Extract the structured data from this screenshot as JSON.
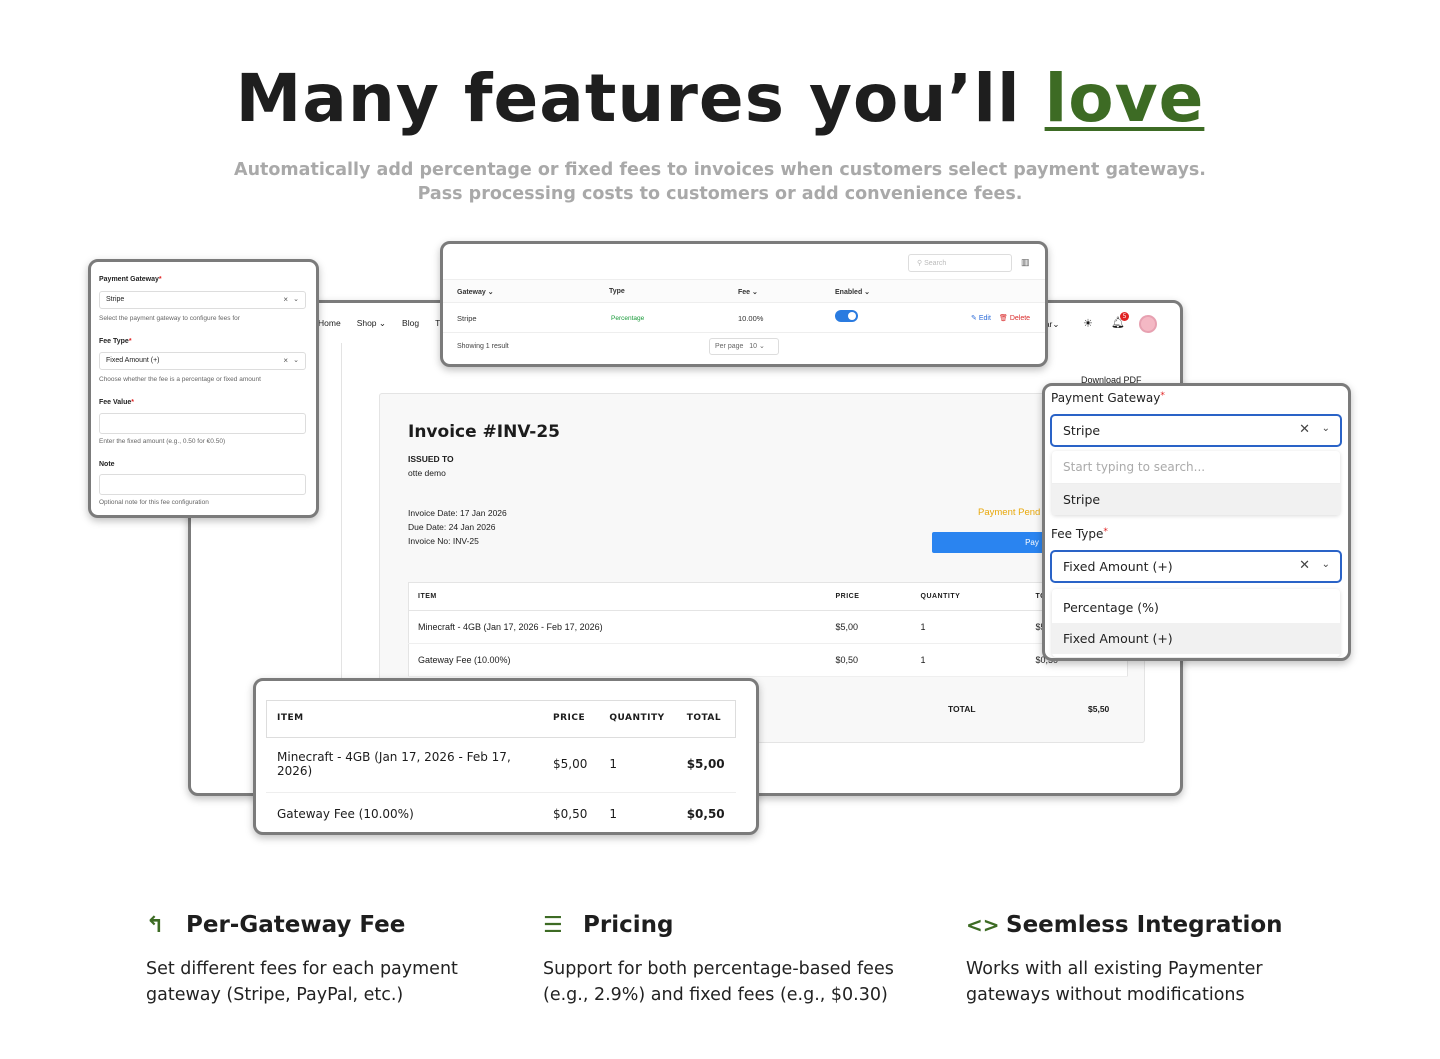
{
  "hero": {
    "title_prefix": "Many features you’ll",
    "title_highlight": "love",
    "subtitle": "Automatically add percentage or fixed fees to invoices when customers select payment gateways. Pass processing costs to customers or add convenience fees."
  },
  "main_window": {
    "nav": [
      "Home",
      "Shop",
      "Blog",
      "T"
    ],
    "currency": "llar",
    "notification_count": "5",
    "download_pdf": "Download PDF",
    "invoice": {
      "title": "Invoice #INV-25",
      "issued_to_label": "ISSUED TO",
      "issued_to_name": "otte demo",
      "invoice_date": "Invoice Date: 17 Jan 2026",
      "due_date": "Due Date: 24 Jan 2026",
      "invoice_no": "Invoice No: INV-25",
      "status": "Payment Pend",
      "pay_button": "Pay",
      "columns": [
        "ITEM",
        "PRICE",
        "QUANTITY",
        "TO"
      ],
      "rows": [
        [
          "Minecraft - 4GB (Jan 17, 2026 - Feb 17, 2026)",
          "$5,00",
          "1",
          "$5"
        ],
        [
          "Gateway Fee (10.00%)",
          "$0,50",
          "1",
          "$0,50"
        ]
      ],
      "total_label": "TOTAL",
      "total_value": "$5,50"
    }
  },
  "gateway_table": {
    "search_placeholder": "Search",
    "columns": [
      "Gateway",
      "Type",
      "Fee",
      "Enabled"
    ],
    "row": {
      "gateway": "Stripe",
      "type": "Percentage",
      "fee": "10.00%",
      "enabled": true
    },
    "edit": "Edit",
    "delete": "Delete",
    "showing": "Showing 1 result",
    "per_page_label": "Per page",
    "per_page_value": "10"
  },
  "fee_form": {
    "gateway_label": "Payment Gateway",
    "gateway_value": "Stripe",
    "gateway_help": "Select the payment gateway to configure fees for",
    "fee_type_label": "Fee Type",
    "fee_type_value": "Fixed Amount (+)",
    "fee_type_help": "Choose whether the fee is a percentage or fixed amount",
    "fee_value_label": "Fee Value",
    "fee_value_help": "Enter the fixed amount (e.g., 0.50 for €0.50)",
    "note_label": "Note",
    "note_help": "Optional note for this fee configuration"
  },
  "dropdowns": {
    "gateway_label": "Payment Gateway",
    "gateway_value": "Stripe",
    "search_placeholder": "Start typing to search...",
    "gateway_options": [
      "Stripe"
    ],
    "fee_type_label": "Fee Type",
    "fee_type_value": "Fixed Amount (+)",
    "fee_type_options": [
      "Percentage (%)",
      "Fixed Amount (+)"
    ]
  },
  "zoom_table": {
    "columns": [
      "ITEM",
      "PRICE",
      "QUANTITY",
      "TOTAL"
    ],
    "rows": [
      [
        "Minecraft - 4GB (Jan 17, 2026 - Feb 17, 2026)",
        "$5,00",
        "1",
        "$5,00"
      ],
      [
        "Gateway Fee (10.00%)",
        "$0,50",
        "1",
        "$0,50"
      ]
    ]
  },
  "features": [
    {
      "icon": "reply-arrow-icon",
      "glyph": "↰",
      "title": "Per-Gateway Fee",
      "text": "Set different fees for each payment gateway (Stripe, PayPal, etc.)"
    },
    {
      "icon": "menu-lines-icon",
      "glyph": "☰",
      "title": "Pricing",
      "text": "Support for both percentage-based fees (e.g., 2.9%) and fixed fees (e.g., $0.30)"
    },
    {
      "icon": "code-brackets-icon",
      "glyph": "<>",
      "title": "Seemless Integration",
      "text": "Works with all existing Paymenter gateways without modifications"
    }
  ],
  "colors": {
    "accent": "#3d6b24",
    "primary_blue": "#2a84f0",
    "status_yellow": "#e8a80c",
    "danger": "#e02424"
  }
}
